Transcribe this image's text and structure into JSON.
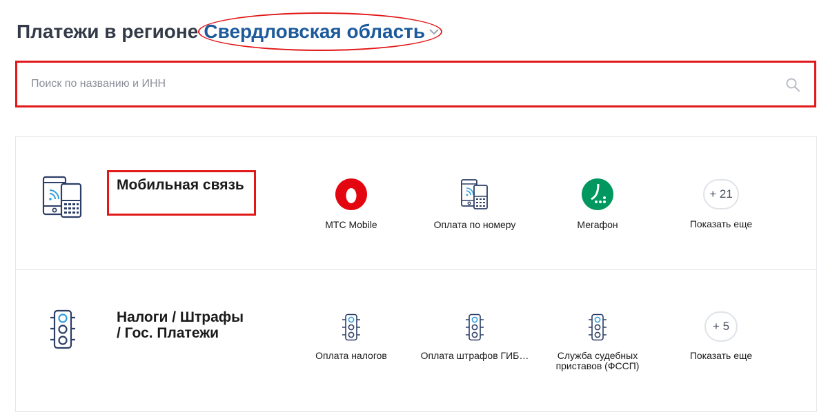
{
  "header": {
    "prefix": "Платежи в регионе",
    "region": "Свердловская область"
  },
  "search": {
    "placeholder": "Поиск по названию и ИНН",
    "value": ""
  },
  "categories": [
    {
      "title": "Мобильная связь",
      "providers": [
        {
          "label": "МТС Mobile",
          "icon": "mts-logo-icon"
        },
        {
          "label": "Оплата по номеру",
          "icon": "phone-icon"
        },
        {
          "label": "Мегафон",
          "icon": "megafon-logo-icon"
        }
      ],
      "more": {
        "count": "+ 21",
        "label": "Показать еще"
      }
    },
    {
      "title_line1": "Налоги / Штрафы",
      "title_line2": "/ Гос. Платежи",
      "providers": [
        {
          "label": "Оплата налогов",
          "icon": "traffic-light-icon"
        },
        {
          "label": "Оплата штрафов ГИБ…",
          "icon": "traffic-light-icon"
        },
        {
          "label": "Служба судебных приставов (ФССП)",
          "icon": "traffic-light-icon"
        }
      ],
      "more": {
        "count": "+ 5",
        "label": "Показать еще"
      }
    }
  ],
  "colors": {
    "accent": "#1c5a9c",
    "highlight": "#e21818",
    "mts_red": "#e30611",
    "megafon_green": "#00985f"
  }
}
